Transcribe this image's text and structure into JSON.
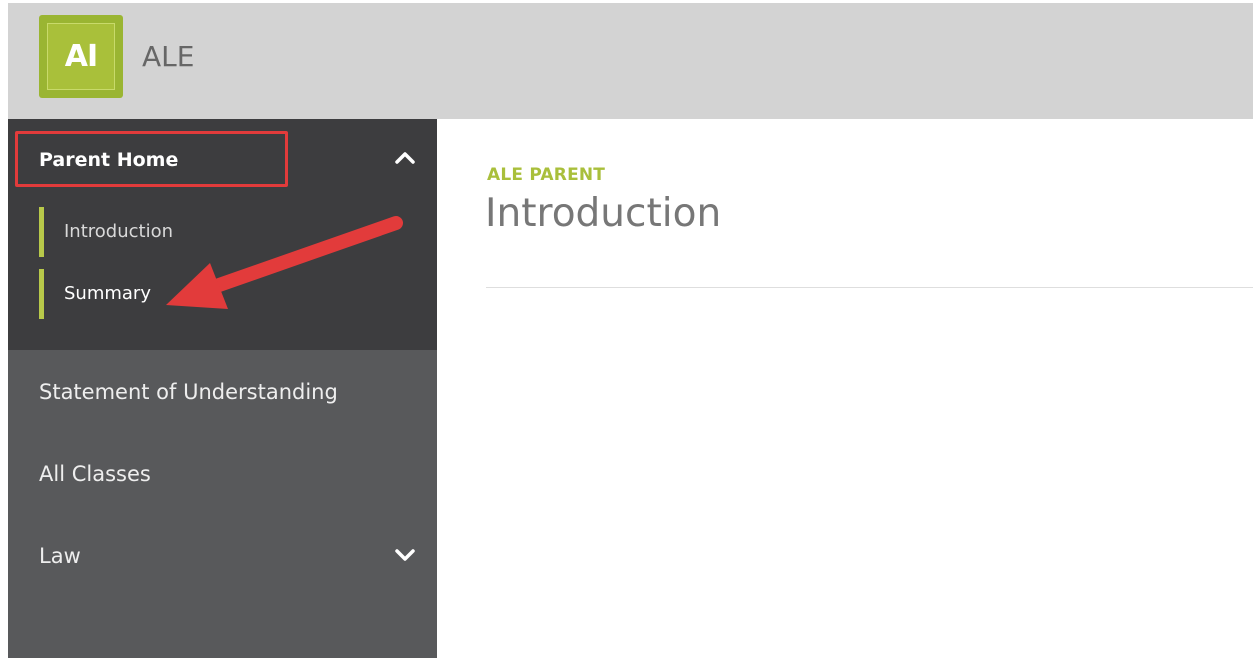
{
  "header": {
    "logo_text": "AI",
    "app_title": "ALE",
    "brand_color": "#a9c03a"
  },
  "sidebar": {
    "parent_home": {
      "label": "Parent Home",
      "icon": "chevron-up-icon",
      "expanded": true,
      "children": [
        {
          "label": "Introduction"
        },
        {
          "label": "Summary"
        }
      ]
    },
    "items": [
      {
        "label": "Statement of Understanding"
      },
      {
        "label": "All Classes"
      },
      {
        "label": "Law",
        "icon": "chevron-down-icon"
      }
    ]
  },
  "main": {
    "kicker": "ALE PARENT",
    "title": "Introduction"
  },
  "colors": {
    "accent": "#a9bf3b",
    "sidebar_bg": "#58595b",
    "sidebar_open_bg": "#3d3d3f",
    "annotation": "#e23b3b"
  }
}
